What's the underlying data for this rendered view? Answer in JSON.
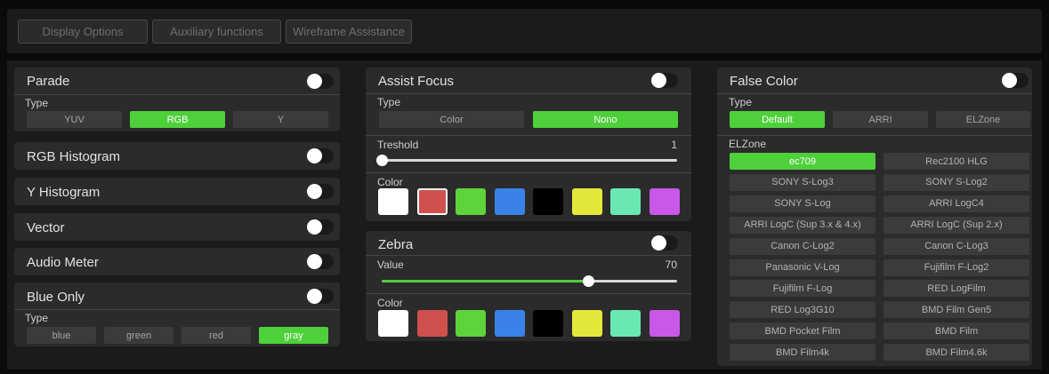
{
  "tabs": [
    "Display Options",
    "Auxiliary functions",
    "Wireframe Assistance"
  ],
  "left": {
    "parade": {
      "title": "Parade",
      "on": true,
      "type_label": "Type",
      "options": [
        "YUV",
        "RGB",
        "Y"
      ],
      "selected": 1
    },
    "rgb_histogram": {
      "title": "RGB Histogram",
      "on": true
    },
    "y_histogram": {
      "title": "Y  Histogram",
      "on": true
    },
    "vector": {
      "title": "Vector",
      "on": true
    },
    "audio_meter": {
      "title": "Audio Meter",
      "on": true
    },
    "blue_only": {
      "title": "Blue Only",
      "on": true,
      "type_label": "Type",
      "options": [
        "blue",
        "green",
        "red",
        "gray"
      ],
      "selected": 3
    }
  },
  "assist_focus": {
    "title": "Assist Focus",
    "on": true,
    "type_label": "Type",
    "options": [
      "Color",
      "Nono"
    ],
    "selected": 1,
    "threshold_label": "Treshold",
    "threshold_value": "1",
    "threshold_fraction": 0.0,
    "color_label": "Color",
    "colors": [
      "#ffffff",
      "#d0504d",
      "#5ed33c",
      "#3a82e8",
      "#000000",
      "#e4e83a",
      "#6ae8b4",
      "#c958e8"
    ],
    "selected_color": 1
  },
  "zebra": {
    "title": "Zebra",
    "on": true,
    "value_label": "Value",
    "value": "70",
    "value_fraction": 0.7,
    "color_label": "Color",
    "colors": [
      "#ffffff",
      "#d0504d",
      "#5ed33c",
      "#3a82e8",
      "#000000",
      "#e4e83a",
      "#6ae8b4",
      "#c958e8"
    ]
  },
  "false_color": {
    "title": "False Color",
    "on": true,
    "type_label": "Type",
    "options": [
      "Default",
      "ARRI",
      "ELZone"
    ],
    "selected": 0,
    "elzone_label": "ELZone",
    "zones": [
      "ec709",
      "Rec2100 HLG",
      "SONY S-Log3",
      "SONY S-Log2",
      "SONY S-Log",
      "ARRI LogC4",
      "ARRI LogC (Sup 3.x & 4.x)",
      "ARRI LogC (Sup 2.x)",
      "Canon C-Log2",
      "Canon C-Log3",
      "Panasonic V-Log",
      "Fujifilm F-Log2",
      "Fujifilm F-Log",
      "RED LogFilm",
      "RED Log3G10",
      "BMD Film Gen5",
      "BMD Pocket Film",
      "BMD Film",
      "BMD Film4k",
      "BMD Film4.6k"
    ],
    "selected_zone": 0
  }
}
